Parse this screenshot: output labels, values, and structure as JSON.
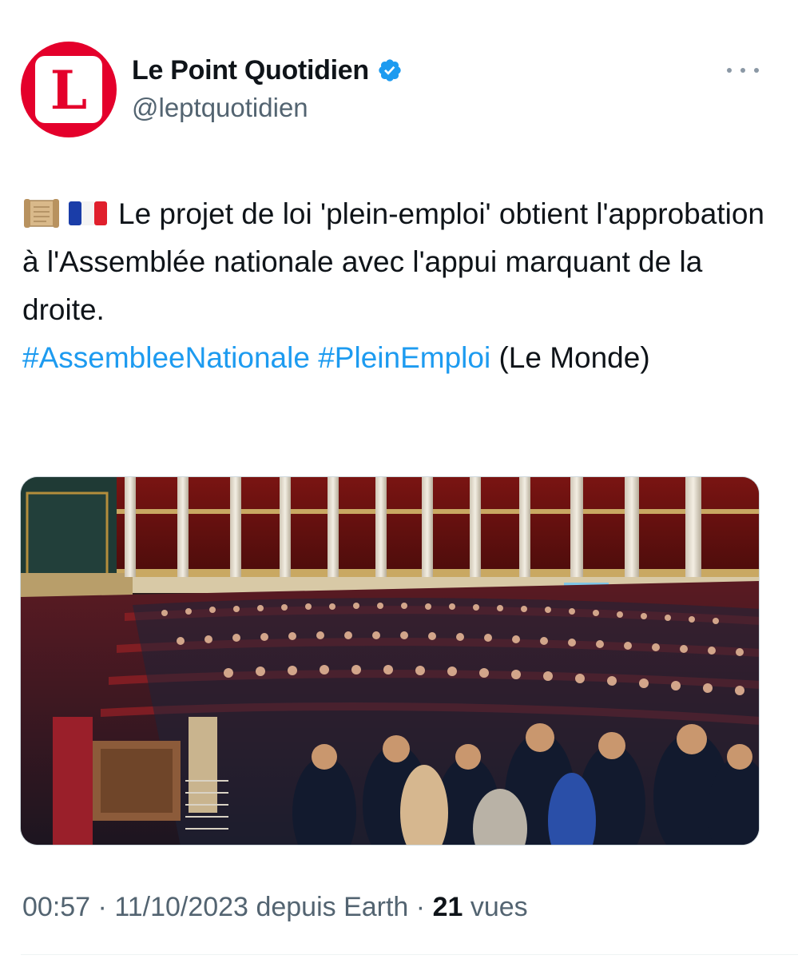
{
  "author": {
    "display_name": "Le Point Quotidien",
    "handle": "@leptquotidien",
    "avatar_letter": "L",
    "avatar_color": "#e4002b",
    "verified": true
  },
  "tweet": {
    "emojis": [
      "scroll-icon",
      "flag-france-icon"
    ],
    "text": "Le projet de loi 'plein-emploi' obtient l'approbation à l'Assemblée nationale avec l'appui marquant de la droite.",
    "hashtags": [
      "#AssembleeNationale",
      "#PleinEmploi"
    ],
    "source_credit": "(Le Monde)"
  },
  "media": {
    "icon": "photo-national-assembly"
  },
  "meta": {
    "time": "00:57",
    "date": "11/10/2023",
    "via": "depuis Earth",
    "separator": "·",
    "views_count": "21",
    "views_label": "vues"
  },
  "colors": {
    "link": "#1d9bf0",
    "secondary_text": "#536471",
    "text": "#0f1419"
  }
}
